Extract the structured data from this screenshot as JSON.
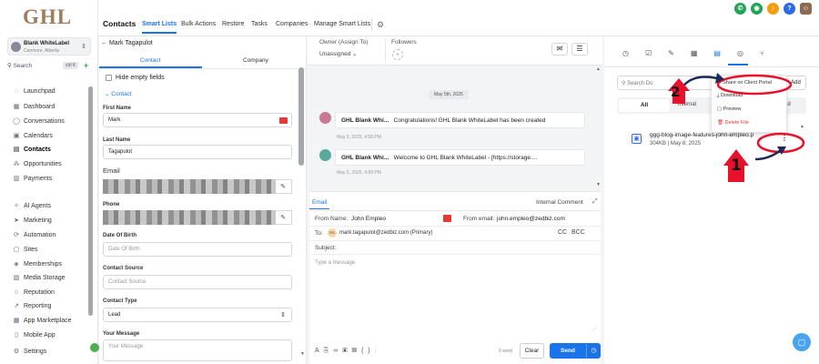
{
  "sidebar": {
    "logo": "GHL",
    "account_name": "Blank WhiteLabel",
    "account_location": "Canmore, Alberta",
    "search_label": "Search",
    "search_shortcut": "ctrl K",
    "items": [
      {
        "label": "Launchpad",
        "icon": "rocket-icon"
      },
      {
        "label": "Dashboard",
        "icon": "grid-icon"
      },
      {
        "label": "Conversations",
        "icon": "chat-icon"
      },
      {
        "label": "Calendars",
        "icon": "calendar-icon"
      },
      {
        "label": "Contacts",
        "icon": "contacts-icon",
        "active": true
      },
      {
        "label": "Opportunities",
        "icon": "funnel-icon"
      },
      {
        "label": "Payments",
        "icon": "payments-icon"
      },
      {
        "label": "AI Agents",
        "icon": "sparkle-icon"
      },
      {
        "label": "Marketing",
        "icon": "send-icon"
      },
      {
        "label": "Automation",
        "icon": "automation-icon"
      },
      {
        "label": "Sites",
        "icon": "sites-icon"
      },
      {
        "label": "Memberships",
        "icon": "membership-icon"
      },
      {
        "label": "Media Storage",
        "icon": "media-icon"
      },
      {
        "label": "Reputation",
        "icon": "star-icon"
      },
      {
        "label": "Reporting",
        "icon": "chart-icon"
      },
      {
        "label": "App Marketplace",
        "icon": "apps-icon"
      },
      {
        "label": "Mobile App",
        "icon": "mobile-icon"
      },
      {
        "label": "Settings",
        "icon": "gear-icon"
      }
    ]
  },
  "topnav": {
    "tabs": [
      "Contacts",
      "Smart Lists",
      "Bulk Actions",
      "Restore",
      "Tasks",
      "Companies",
      "Manage Smart Lists"
    ],
    "selected": "Smart Lists"
  },
  "contact": {
    "back_name": "Mark Tagapulot",
    "tabs": [
      "Contact",
      "Company"
    ],
    "hide_empty": "Hide empty fields",
    "section": "Contact",
    "first_name_label": "First Name",
    "first_name": "Mark",
    "last_name_label": "Last Name",
    "last_name": "Tagapulot",
    "email_label": "Email",
    "phone_label": "Phone",
    "dob_label": "Date Of Birth",
    "dob_placeholder": "Date Of Birth",
    "source_label": "Contact Source",
    "source_placeholder": "Contact Source",
    "type_label": "Contact Type",
    "type_value": "Lead",
    "message_label": "Your Message",
    "message_placeholder": "Your Message"
  },
  "conversation": {
    "owner_label": "Owner (Assign To)",
    "owner_value": "Unassigned",
    "followers_label": "Followers",
    "date_divider": "May 5th, 2025",
    "messages": [
      {
        "sender": "GHL Blank Whi...",
        "text": "Congratulations! GHL Blank WhiteLabel has been created",
        "time": "May 5, 2025, 4:58 PM"
      },
      {
        "sender": "GHL Blank Whi...",
        "text": "Welcome to GHL Blank WhiteLabel  -  [https://storage....",
        "time": "May 5, 2025, 4:58 PM"
      }
    ]
  },
  "composer": {
    "tab_email": "Email",
    "internal_comment": "Internal Comment",
    "from_name_label": "From Name:",
    "from_name": "John Empleo",
    "from_email_label": "From email:",
    "from_email": "john.empleo@zedbiz.com",
    "to_label": "To:",
    "to_value": "mark.tagapulot@zedbiz.com (Primary)",
    "cc": "CC",
    "bcc": "BCC",
    "subject_label": "Subject:",
    "body_placeholder": "Type a message",
    "word_count": "0 word",
    "clear": "Clear",
    "send": "Send"
  },
  "files": {
    "search_placeholder": "Search Do",
    "add": "Add",
    "tabs_all": "All",
    "tabs_internal": "Internal",
    "tabs_shared": "ed",
    "file_name": "ggg-blog-image-features-john-empleo.p",
    "file_meta": "304KB | May 8, 2025",
    "menu": [
      "Share on Client Portal",
      "Download",
      "Preview",
      "Delete File"
    ]
  },
  "annotations": {
    "step1": "1",
    "step2": "2"
  },
  "colors": {
    "accent": "#1a73e8",
    "annotation_red": "#e8102a",
    "send_button": "#1a73e8"
  }
}
